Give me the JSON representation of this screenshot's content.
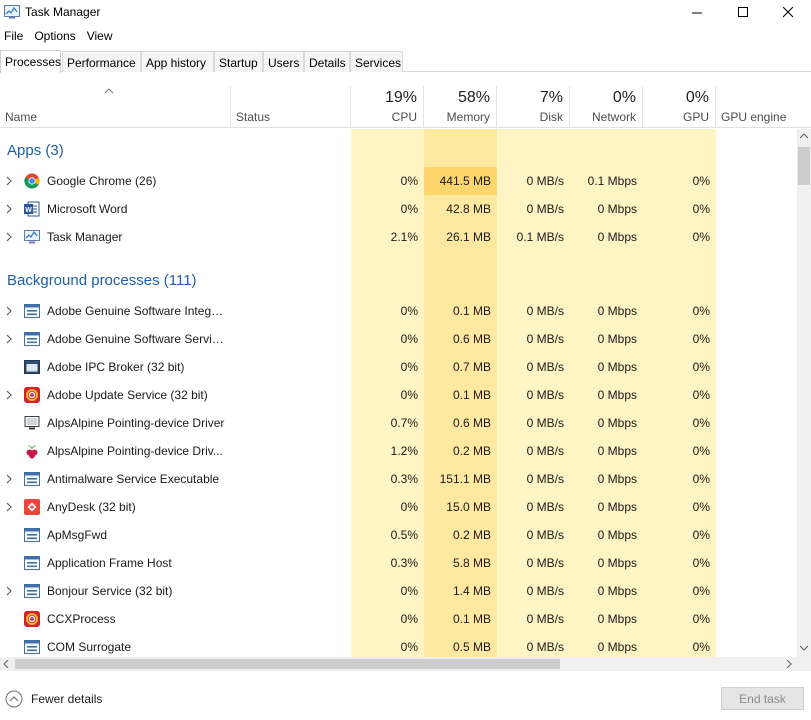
{
  "window": {
    "title": "Task Manager"
  },
  "menu": [
    "File",
    "Options",
    "View"
  ],
  "tabs": [
    "Processes",
    "Performance",
    "App history",
    "Startup",
    "Users",
    "Details",
    "Services"
  ],
  "active_tab": "Processes",
  "header": {
    "name": "Name",
    "status": "Status",
    "cpu": {
      "pct": "19%",
      "label": "CPU"
    },
    "memory": {
      "pct": "58%",
      "label": "Memory"
    },
    "disk": {
      "pct": "7%",
      "label": "Disk"
    },
    "network": {
      "pct": "0%",
      "label": "Network"
    },
    "gpu": {
      "pct": "0%",
      "label": "GPU"
    },
    "gpu_engine": "GPU engine"
  },
  "groups": [
    {
      "title": "Apps (3)",
      "rows": [
        {
          "name": "Google Chrome (26)",
          "icon": "chrome-icon",
          "expandable": true,
          "cpu": "0%",
          "memory": "441.5 MB",
          "disk": "0 MB/s",
          "network": "0.1 Mbps",
          "gpu": "0%",
          "memory_highlight": true
        },
        {
          "name": "Microsoft Word",
          "icon": "word-icon",
          "expandable": true,
          "cpu": "0%",
          "memory": "42.8 MB",
          "disk": "0 MB/s",
          "network": "0 Mbps",
          "gpu": "0%"
        },
        {
          "name": "Task Manager",
          "icon": "task-manager-icon",
          "expandable": true,
          "cpu": "2.1%",
          "memory": "26.1 MB",
          "disk": "0.1 MB/s",
          "network": "0 Mbps",
          "gpu": "0%"
        }
      ]
    },
    {
      "title": "Background processes (111)",
      "rows": [
        {
          "name": "Adobe Genuine Software Integri...",
          "icon": "service-icon",
          "expandable": true,
          "cpu": "0%",
          "memory": "0.1 MB",
          "disk": "0 MB/s",
          "network": "0 Mbps",
          "gpu": "0%"
        },
        {
          "name": "Adobe Genuine Software Servic...",
          "icon": "service-icon",
          "expandable": true,
          "cpu": "0%",
          "memory": "0.6 MB",
          "disk": "0 MB/s",
          "network": "0 Mbps",
          "gpu": "0%"
        },
        {
          "name": "Adobe IPC Broker (32 bit)",
          "icon": "app-window-icon",
          "expandable": false,
          "cpu": "0%",
          "memory": "0.7 MB",
          "disk": "0 MB/s",
          "network": "0 Mbps",
          "gpu": "0%"
        },
        {
          "name": "Adobe Update Service (32 bit)",
          "icon": "adobe-cc-icon",
          "expandable": true,
          "cpu": "0%",
          "memory": "0.1 MB",
          "disk": "0 MB/s",
          "network": "0 Mbps",
          "gpu": "0%"
        },
        {
          "name": "AlpsAlpine Pointing-device Driver",
          "icon": "monitor-icon",
          "expandable": false,
          "cpu": "0.7%",
          "memory": "0.6 MB",
          "disk": "0 MB/s",
          "network": "0 Mbps",
          "gpu": "0%"
        },
        {
          "name": "AlpsAlpine Pointing-device Driv...",
          "icon": "raspberry-icon",
          "expandable": false,
          "cpu": "1.2%",
          "memory": "0.2 MB",
          "disk": "0 MB/s",
          "network": "0 Mbps",
          "gpu": "0%"
        },
        {
          "name": "Antimalware Service Executable",
          "icon": "service-icon",
          "expandable": true,
          "cpu": "0.3%",
          "memory": "151.1 MB",
          "disk": "0 MB/s",
          "network": "0 Mbps",
          "gpu": "0%"
        },
        {
          "name": "AnyDesk (32 bit)",
          "icon": "anydesk-icon",
          "expandable": true,
          "cpu": "0%",
          "memory": "15.0 MB",
          "disk": "0 MB/s",
          "network": "0 Mbps",
          "gpu": "0%"
        },
        {
          "name": "ApMsgFwd",
          "icon": "service-icon",
          "expandable": false,
          "cpu": "0.5%",
          "memory": "0.2 MB",
          "disk": "0 MB/s",
          "network": "0 Mbps",
          "gpu": "0%"
        },
        {
          "name": "Application Frame Host",
          "icon": "service-icon",
          "expandable": false,
          "cpu": "0.3%",
          "memory": "5.8 MB",
          "disk": "0 MB/s",
          "network": "0 Mbps",
          "gpu": "0%"
        },
        {
          "name": "Bonjour Service (32 bit)",
          "icon": "service-icon",
          "expandable": true,
          "cpu": "0%",
          "memory": "1.4 MB",
          "disk": "0 MB/s",
          "network": "0 Mbps",
          "gpu": "0%"
        },
        {
          "name": "CCXProcess",
          "icon": "adobe-cc-icon",
          "expandable": false,
          "cpu": "0%",
          "memory": "0.1 MB",
          "disk": "0 MB/s",
          "network": "0 Mbps",
          "gpu": "0%"
        },
        {
          "name": "COM Surrogate",
          "icon": "service-icon",
          "expandable": false,
          "cpu": "0%",
          "memory": "0.5 MB",
          "disk": "0 MB/s",
          "network": "0 Mbps",
          "gpu": "0%"
        }
      ]
    }
  ],
  "footer": {
    "fewer_details": "Fewer details",
    "end_task": "End task"
  },
  "colors": {
    "heat_light": "#fff4c4",
    "heat_mid": "#ffe9a1",
    "heat_high": "#ffd66b",
    "group_title": "#1e5fa6"
  }
}
